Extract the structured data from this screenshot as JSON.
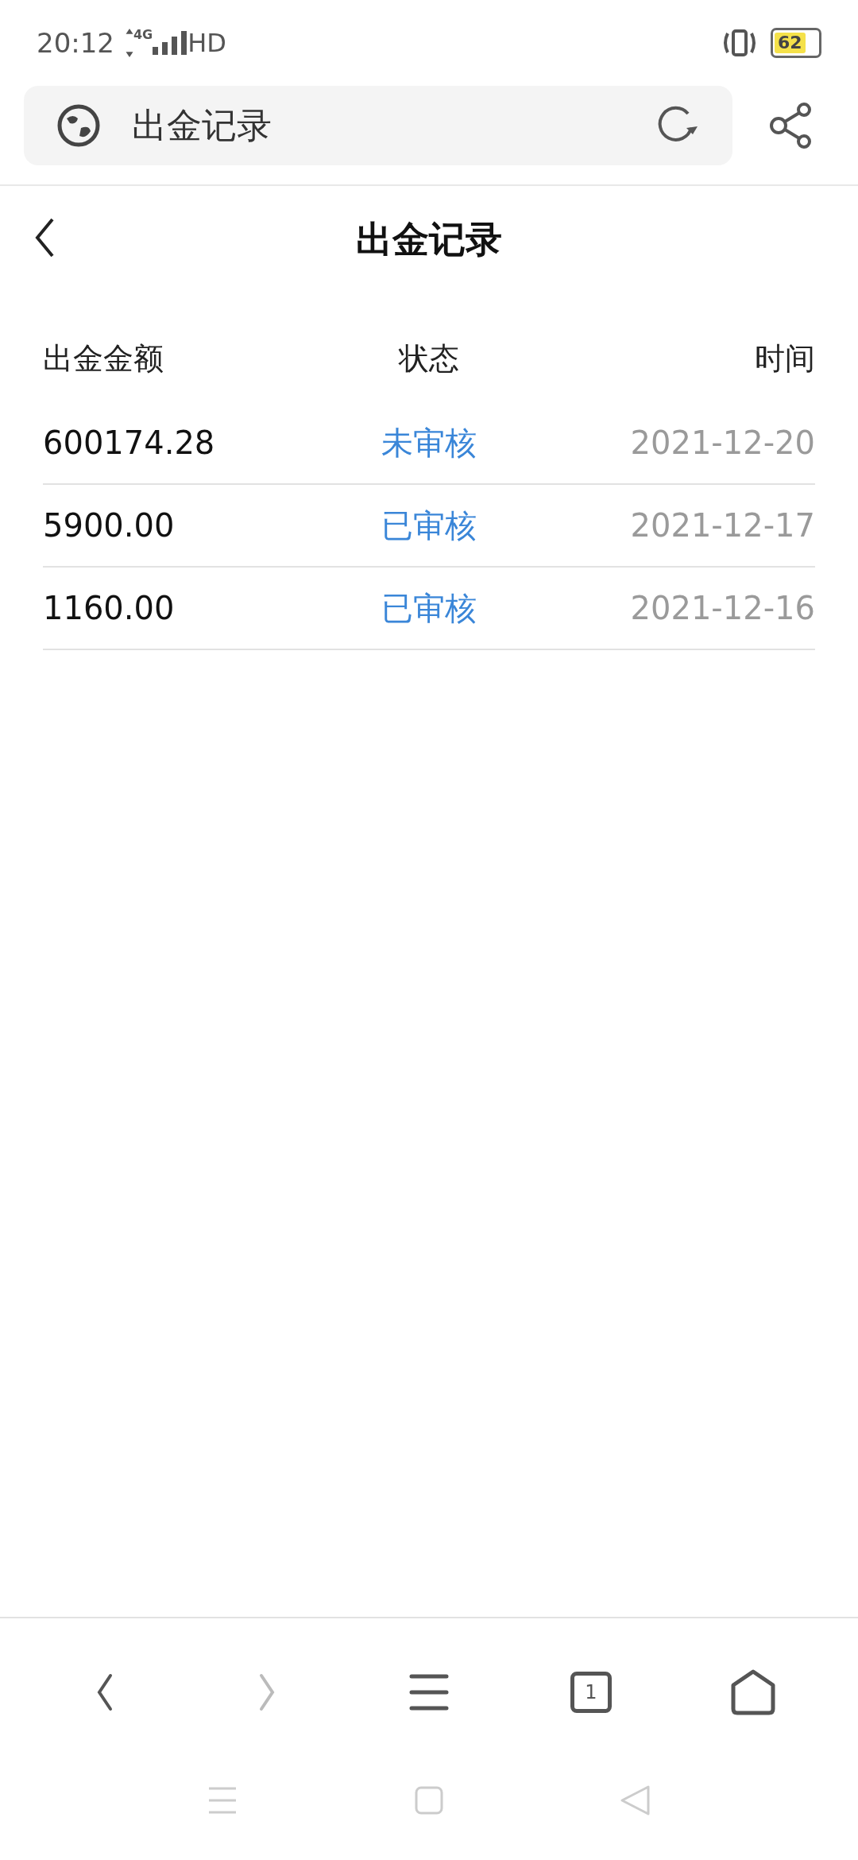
{
  "status_bar": {
    "time": "20:12",
    "network": "4G",
    "hd": "HD",
    "battery": "62"
  },
  "browser_bar": {
    "title": "出金记录"
  },
  "page": {
    "title": "出金记录"
  },
  "table": {
    "columns": [
      "出金金额",
      "状态",
      "时间"
    ],
    "rows": [
      {
        "amount": "600174.28",
        "status": "未审核",
        "date": "2021-12-20"
      },
      {
        "amount": "5900.00",
        "status": "已审核",
        "date": "2021-12-17"
      },
      {
        "amount": "1160.00",
        "status": "已审核",
        "date": "2021-12-16"
      }
    ]
  },
  "bottom_nav": {
    "forward_disabled": true,
    "tab_count": "1"
  }
}
